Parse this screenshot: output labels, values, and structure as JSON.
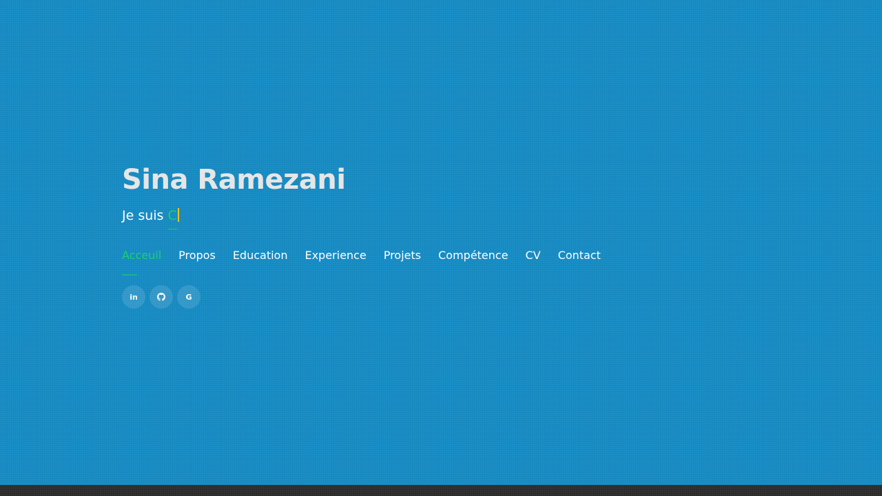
{
  "hero": {
    "name": "Sina Ramezani",
    "subtitle_prefix": "Je suis ",
    "typed_text": "C"
  },
  "nav": {
    "items": [
      {
        "label": "Acceuil",
        "active": true
      },
      {
        "label": "Propos"
      },
      {
        "label": "Education"
      },
      {
        "label": "Experience"
      },
      {
        "label": "Projets"
      },
      {
        "label": "Compétence"
      },
      {
        "label": "CV"
      },
      {
        "label": "Contact"
      }
    ]
  },
  "social": {
    "linkedin_glyph": "in",
    "google_glyph": "G",
    "icons": [
      "linkedin-icon",
      "github-icon",
      "google-icon"
    ]
  },
  "colors": {
    "background": "#1a8fc7",
    "accent": "#18d26e",
    "cursor": "#f0c419",
    "bottom_strip": "#2b2b2b"
  }
}
